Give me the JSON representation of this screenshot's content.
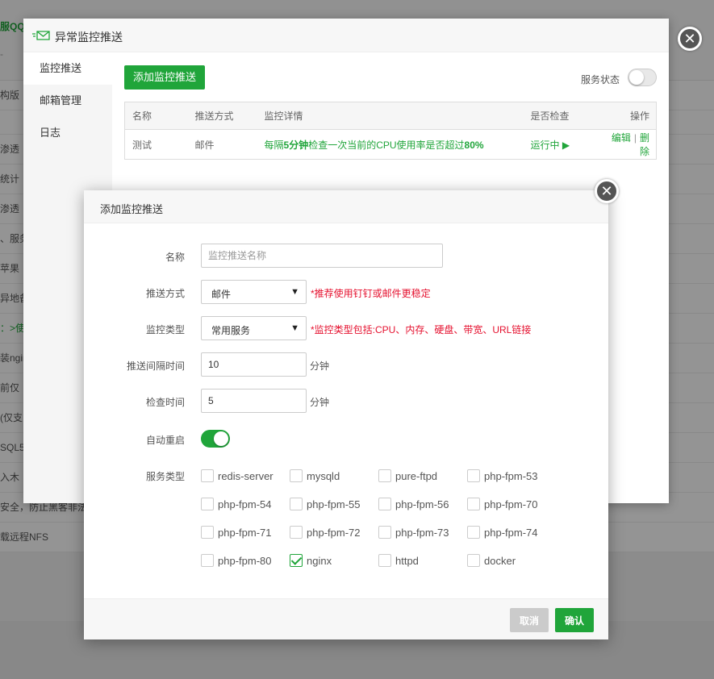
{
  "background": {
    "top_label": "服QQ",
    "top_dash": "-",
    "rows": [
      "构版",
      "",
      "渗透",
      "统计",
      "渗透",
      "、服务",
      "苹果",
      "异地备",
      "：>使",
      "装ngin",
      "前仅",
      "(仅支",
      "SQL5",
      "入木",
      "安全，防止黑客非法",
      "载远程NFS"
    ]
  },
  "dialog1": {
    "title": "异常监控推送",
    "sidebar": [
      "监控推送",
      "邮箱管理",
      "日志"
    ],
    "add_button": "添加监控推送",
    "service_status_label": "服务状态",
    "table": {
      "headers": [
        "名称",
        "推送方式",
        "监控详情",
        "是否检查",
        "操作"
      ],
      "row": {
        "name": "测试",
        "method": "邮件",
        "detail_prefix": "每隔",
        "detail_interval": "5分钟",
        "detail_middle": "检查一次当前的CPU使用率是否超过",
        "detail_threshold": "80%",
        "state": "运行中 ▶",
        "edit": "编辑",
        "sep": "|",
        "delete": "删除"
      }
    }
  },
  "dialog2": {
    "title": "添加监控推送",
    "name_label": "名称",
    "name_placeholder": "监控推送名称",
    "name_value": "",
    "push_label": "推送方式",
    "push_value": "邮件",
    "push_hint": "*推荐使用钉钉或邮件更稳定",
    "type_label": "监控类型",
    "type_value": "常用服务",
    "type_hint": "*监控类型包括:CPU、内存、硬盘、带宽、URL链接",
    "interval_label": "推送间隔时间",
    "interval_value": "10",
    "interval_unit": "分钟",
    "check_label": "检查时间",
    "check_value": "5",
    "check_unit": "分钟",
    "restart_label": "自动重启",
    "restart_on": true,
    "services_label": "服务类型",
    "services": [
      {
        "name": "redis-server",
        "checked": false
      },
      {
        "name": "mysqld",
        "checked": false
      },
      {
        "name": "pure-ftpd",
        "checked": false
      },
      {
        "name": "php-fpm-53",
        "checked": false
      },
      {
        "name": "php-fpm-54",
        "checked": false
      },
      {
        "name": "php-fpm-55",
        "checked": false
      },
      {
        "name": "php-fpm-56",
        "checked": false
      },
      {
        "name": "php-fpm-70",
        "checked": false
      },
      {
        "name": "php-fpm-71",
        "checked": false
      },
      {
        "name": "php-fpm-72",
        "checked": false
      },
      {
        "name": "php-fpm-73",
        "checked": false
      },
      {
        "name": "php-fpm-74",
        "checked": false
      },
      {
        "name": "php-fpm-80",
        "checked": false
      },
      {
        "name": "nginx",
        "checked": true
      },
      {
        "name": "httpd",
        "checked": false
      },
      {
        "name": "docker",
        "checked": false
      }
    ],
    "cancel": "取消",
    "confirm": "确认"
  },
  "colors": {
    "accent": "#20a53a",
    "hint": "#e5102e"
  }
}
